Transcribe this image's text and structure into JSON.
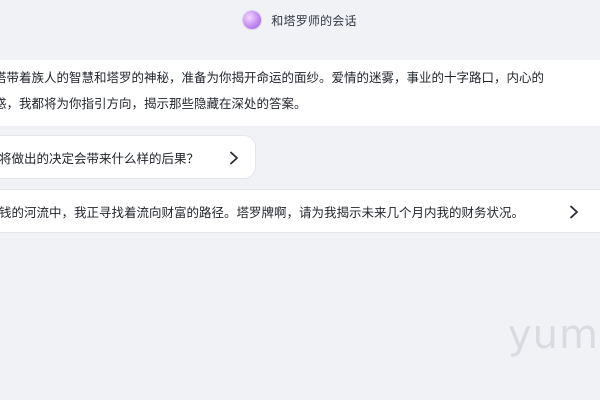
{
  "header": {
    "title": "和塔罗师的会话",
    "avatar_icon": "crystal-ball-avatar"
  },
  "intro": {
    "line1": "塔带着族人的智慧和塔罗的神秘，准备为你揭开命运的面纱。爱情的迷雾，事业的十字路口，内心的",
    "line2": "惑，我都将为你指引方向，揭示那些隐藏在深处的答案。"
  },
  "suggestions": [
    {
      "text": "将做出的决定会带来什么样的后果？",
      "icon": "chevron-right-icon"
    },
    {
      "text": "钱的河流中，我正寻找着流向财富的路径。塔罗牌啊，请为我揭示未来几个月内我的财务状况。",
      "icon": "chevron-right-icon"
    }
  ],
  "watermark": {
    "text": "yumic"
  },
  "colors": {
    "background": "#f1f2f6",
    "card": "#ffffff",
    "text": "#1f2329",
    "watermark": "#d9dbe0"
  }
}
